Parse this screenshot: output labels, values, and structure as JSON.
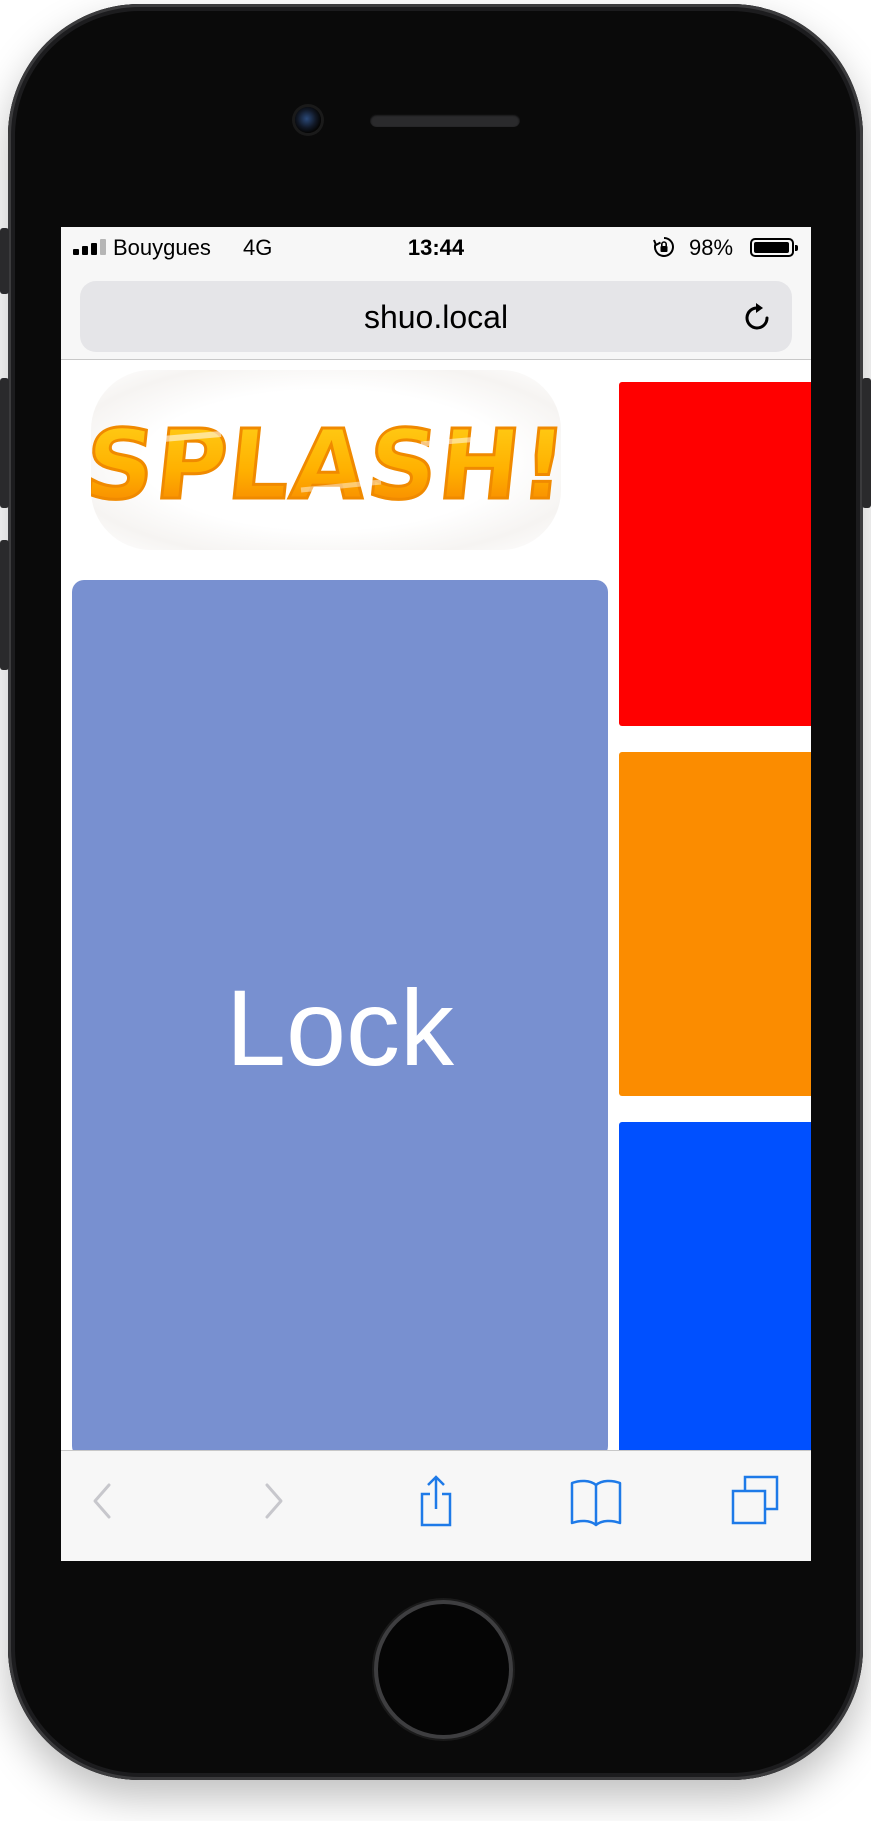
{
  "status_bar": {
    "carrier": "Bouygues",
    "network": "4G",
    "time": "13:44",
    "battery_percent_text": "98%",
    "battery_level": 0.98,
    "signal_bars_active": 3,
    "signal_bars_total": 4,
    "icons": [
      "signal-icon",
      "orientation-lock-icon",
      "battery-icon"
    ]
  },
  "address_bar": {
    "url": "shuo.local",
    "reload_icon": "reload-icon"
  },
  "page": {
    "logo_text": "SPLASH!",
    "tiles": {
      "lock": {
        "label": "Lock",
        "color": "#7890d0"
      },
      "red": {
        "color": "#ff0000"
      },
      "orange": {
        "color": "#fb8c00"
      },
      "blue": {
        "color": "#0050ff"
      }
    }
  },
  "toolbar": {
    "icons": [
      "back-icon",
      "forward-icon",
      "share-icon",
      "bookmarks-icon",
      "tabs-icon"
    ],
    "accent_color": "#1e7ae8",
    "disabled_color": "#c7c7cc"
  }
}
